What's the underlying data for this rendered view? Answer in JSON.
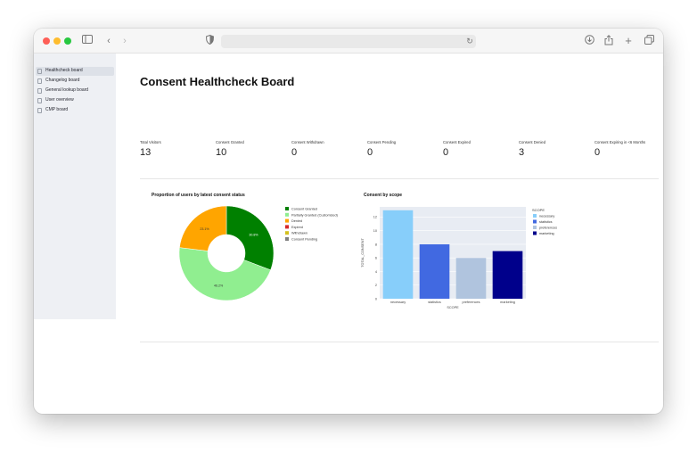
{
  "browser": {
    "colors": {
      "close": "#fe5f57",
      "minimize": "#febc2e",
      "zoom": "#28c840"
    },
    "icons": [
      "sidebar-toggle-icon",
      "back-icon",
      "forward-icon",
      "shield-icon",
      "reload-icon",
      "download-icon",
      "share-icon",
      "new-tab-icon",
      "tabs-overview-icon"
    ]
  },
  "sidebar": {
    "items": [
      {
        "label": "Healthcheck board",
        "active": true
      },
      {
        "label": "Changelog board",
        "active": false
      },
      {
        "label": "General lookup board",
        "active": false
      },
      {
        "label": "User overview",
        "active": false
      },
      {
        "label": "CMP board",
        "active": false
      }
    ]
  },
  "page": {
    "title": "Consent Healthcheck Board"
  },
  "metrics": [
    {
      "label": "Total Visitors",
      "value": "13"
    },
    {
      "label": "Consent Granted",
      "value": "10"
    },
    {
      "label": "Consent Withdrawn",
      "value": "0"
    },
    {
      "label": "Consent Pending",
      "value": "0"
    },
    {
      "label": "Consent Expired",
      "value": "0"
    },
    {
      "label": "Consent Denied",
      "value": "3"
    },
    {
      "label": "Consent Expiring in <6 Months",
      "value": "0"
    }
  ],
  "chart_data": [
    {
      "type": "pie",
      "title": "Proportion of users by latest consent status",
      "hole": true,
      "legend": "right",
      "slices": [
        {
          "label": "Consent Granted",
          "value": 30.8,
          "color": "#008000",
          "text": "30.8%"
        },
        {
          "label": "Partially Granted (Customized)",
          "value": 46.2,
          "color": "#90ee90",
          "text": "46.2%"
        },
        {
          "label": "Denied",
          "value": 23.1,
          "color": "#ffa500",
          "text": "23.1%"
        },
        {
          "label": "Expired",
          "value": 0,
          "color": "#d62728",
          "text": ""
        },
        {
          "label": "Withdrawn",
          "value": 0,
          "color": "#d4c11e",
          "text": ""
        },
        {
          "label": "Consent Pending",
          "value": 0,
          "color": "#808080",
          "text": ""
        }
      ]
    },
    {
      "type": "bar",
      "title": "Consent by scope",
      "xlabel": "SCOPE",
      "ylabel": "TOTAL_CONSENT",
      "ylim": [
        0,
        13.5
      ],
      "yticks": [
        0,
        2,
        4,
        6,
        8,
        10,
        12
      ],
      "legend_title": "SCOPE",
      "legend": "right",
      "grid": true,
      "categories": [
        "necessary",
        "statistics",
        "preferences",
        "marketing"
      ],
      "values": [
        13,
        8,
        6,
        7
      ],
      "colors": [
        "#87cefa",
        "#4169e1",
        "#b0c4de",
        "#00008b"
      ]
    }
  ]
}
